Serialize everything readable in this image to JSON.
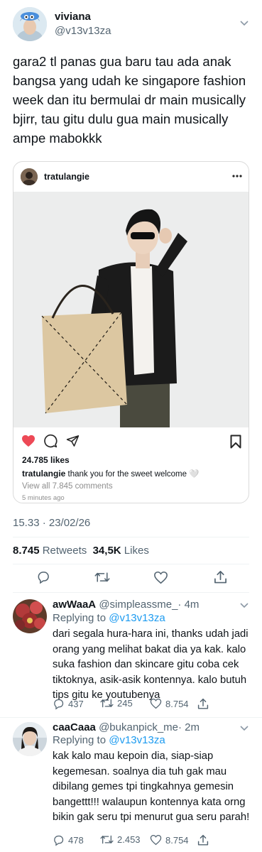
{
  "main_tweet": {
    "author_name": "viviana",
    "author_handle": "@v13v13za",
    "text": "gara2 tl panas gua baru tau ada anak bangsa yang udah ke singapore fashion week dan itu bermulai dr main musically bjirr, tau gitu dulu gua main musically ampe mabokkk",
    "timestamp": "15.33 · 23/02/26",
    "retweets_count": "8.745",
    "retweets_label": "Retweets",
    "likes_count": "34,5K",
    "likes_label": "Likes"
  },
  "instagram_embed": {
    "username": "tratulangie",
    "likes": "24.785 likes",
    "caption_user": "tratulangie",
    "caption": "thank you for the sweet welcome 🤍",
    "view_comments": "View all 7.845 comments",
    "time_ago": "5 minutes ago"
  },
  "replies": [
    {
      "name": "awWaaA",
      "handle": "@simpleassme_",
      "time": "· 4m",
      "replying_prefix": "Replying to",
      "replying_to": "@v13v13za",
      "text": "dari segala hura-hara ini, thanks udah jadi orang yang melihat bakat dia ya kak. kalo suka fashion dan skincare gitu coba cek tiktoknya, asik-asik kontennya. kalo butuh tips gitu ke youtubenya",
      "replies": "437",
      "retweets": "245",
      "likes": "8.754"
    },
    {
      "name": "caaCaaa",
      "handle": "@bukanpick_me",
      "time": "· 2m",
      "replying_prefix": "Replying to",
      "replying_to": "@v13v13za",
      "text": "kak kalo mau kepoin dia, siap-siap kegemesan. soalnya dia tuh gak mau dibilang gemes tpi tingkahnya gemesin bangettt!!! walaupun kontennya kata orng bikin gak seru tpi menurut gua seru parah!",
      "replies": "478",
      "retweets": "2.453",
      "likes": "8.754"
    }
  ],
  "icons": [
    "chevron-down-icon",
    "more-icon",
    "heart-filled-icon",
    "comment-icon",
    "share-icon",
    "bookmark-icon",
    "reply-icon",
    "retweet-icon",
    "like-icon",
    "upload-icon"
  ],
  "colors": {
    "text": "#0f1419",
    "secondary": "#536471",
    "link": "#1d9bf0",
    "ig_heart": "#ed4956",
    "divider": "#eff3f4"
  }
}
